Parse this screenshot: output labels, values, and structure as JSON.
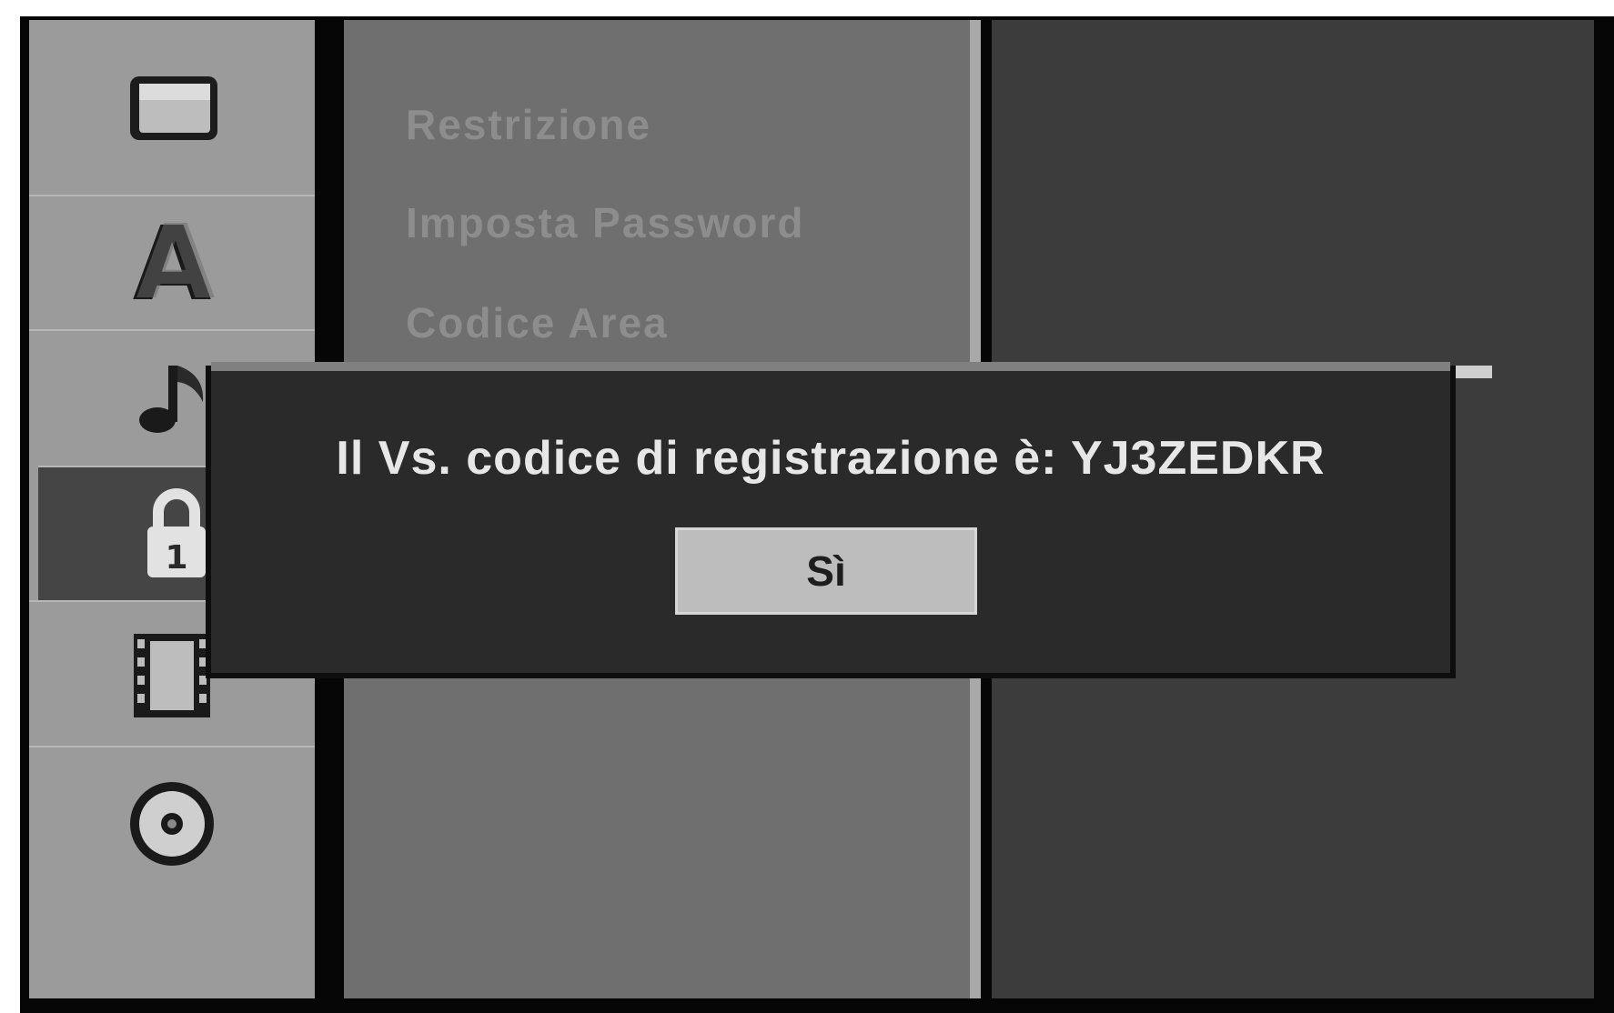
{
  "sidebar": {
    "items": [
      {
        "icon": "tv-screen-icon"
      },
      {
        "icon": "letter-a-icon"
      },
      {
        "icon": "audio-note-icon"
      },
      {
        "icon": "padlock-icon"
      },
      {
        "icon": "film-strip-icon"
      },
      {
        "icon": "disc-icon"
      }
    ],
    "active_index": 3
  },
  "menu": {
    "items": [
      {
        "label": "Restrizione"
      },
      {
        "label": "Imposta Password"
      },
      {
        "label": "Codice Area"
      }
    ]
  },
  "dialog": {
    "message": "Il Vs. codice di registrazione è: YJ3ZEDKR",
    "button_label": "Sì"
  },
  "colors": {
    "sidebar_bg": "#9b9b9b",
    "sidebar_active": "#454545",
    "menu_bg": "#6f6f6f",
    "right_bg": "#3c3c3c",
    "dialog_bg": "#2a2a2a",
    "button_bg": "#bdbdbd"
  }
}
